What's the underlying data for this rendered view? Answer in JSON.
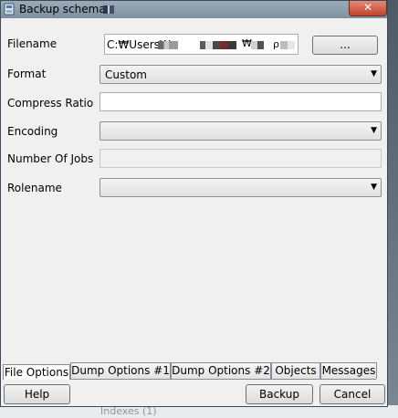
{
  "window": {
    "title": "Backup schema",
    "close_label": "✕"
  },
  "form": {
    "filename": {
      "label": "Filename",
      "value": "C:₩Users₩",
      "mid_text": "₩",
      "end_text": "ρ",
      "browse_label": "..."
    },
    "format": {
      "label": "Format",
      "value": "Custom"
    },
    "compress_ratio": {
      "label": "Compress Ratio",
      "value": ""
    },
    "encoding": {
      "label": "Encoding",
      "value": ""
    },
    "jobs": {
      "label": "Number Of Jobs",
      "value": ""
    },
    "rolename": {
      "label": "Rolename",
      "value": ""
    }
  },
  "tabs": [
    {
      "label": "File Options",
      "active": true
    },
    {
      "label": "Dump Options #1"
    },
    {
      "label": "Dump Options #2"
    },
    {
      "label": "Objects"
    },
    {
      "label": "Messages"
    }
  ],
  "buttons": {
    "help": "Help",
    "backup": "Backup",
    "cancel": "Cancel"
  },
  "background": {
    "ghost_text": "Indexes (1)"
  },
  "icons": {
    "app": "database-backup-icon",
    "dropdown": "chevron-down-icon"
  }
}
